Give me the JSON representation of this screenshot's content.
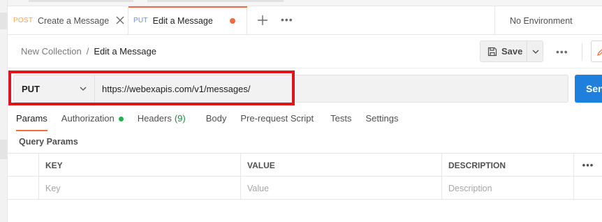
{
  "tabs": [
    {
      "method": "POST",
      "title": "Create a Message"
    },
    {
      "method": "PUT",
      "title": "Edit a Message",
      "unsaved": true
    }
  ],
  "environment": {
    "label": "No Environment"
  },
  "breadcrumb": {
    "collection": "New Collection",
    "separator": "/",
    "request": "Edit a Message"
  },
  "toolbar": {
    "save_label": "Save"
  },
  "request": {
    "method": "PUT",
    "url": "https://webexapis.com/v1/messages/",
    "send_label": "Sen"
  },
  "request_tabs": [
    {
      "label": "Params",
      "active": true
    },
    {
      "label": "Authorization",
      "status_dot": true
    },
    {
      "label": "Headers",
      "count": "(9)"
    },
    {
      "label": "Body"
    },
    {
      "label": "Pre-request Script"
    },
    {
      "label": "Tests"
    },
    {
      "label": "Settings"
    }
  ],
  "query_params": {
    "title": "Query Params",
    "columns": {
      "key": "KEY",
      "value": "VALUE",
      "description": "DESCRIPTION"
    },
    "placeholders": {
      "key": "Key",
      "value": "Value",
      "description": "Description"
    }
  },
  "colors": {
    "accent": "#f26b3a",
    "send_button": "#1e7fdc",
    "highlight": "#e0121b",
    "status_green": "#1fb34b"
  },
  "icons": [
    "close-icon",
    "unsaved-dot-icon",
    "plus-icon",
    "more-icon",
    "save-icon",
    "chevron-down-icon",
    "pencil-icon"
  ]
}
